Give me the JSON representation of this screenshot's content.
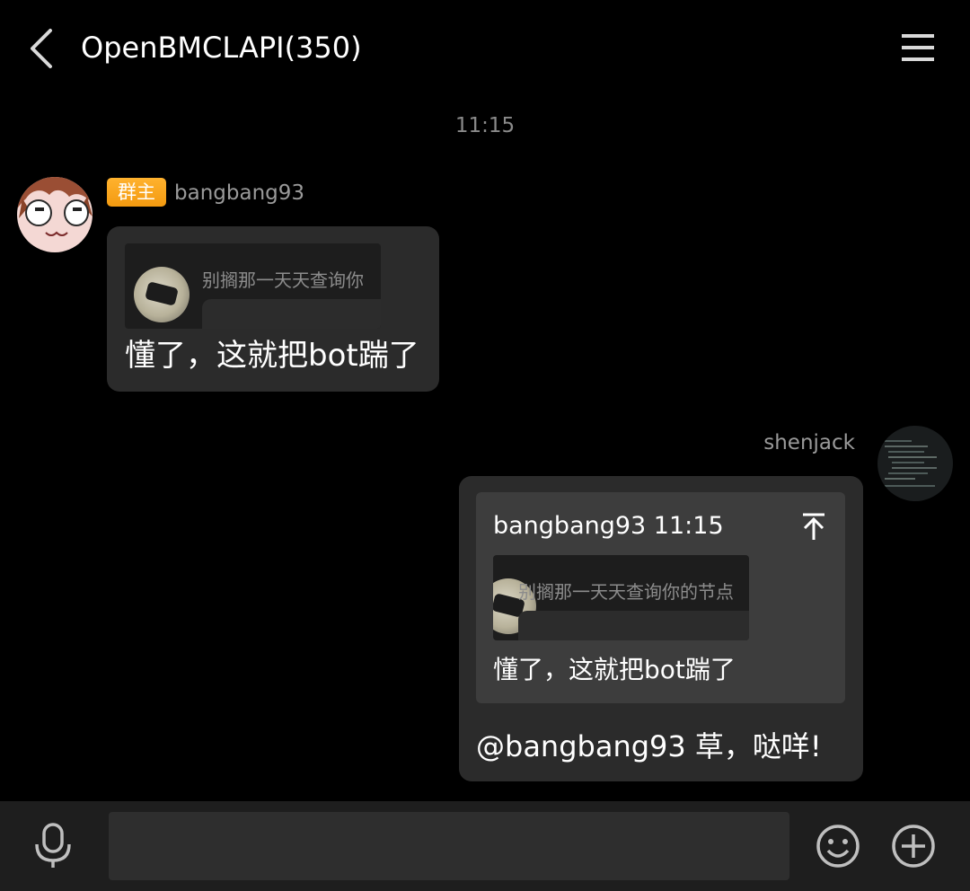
{
  "header": {
    "title": "OpenBMCLAPI(350)",
    "back_icon": "chevron-left-icon",
    "menu_icon": "hamburger-menu-icon"
  },
  "time_divider": "11:15",
  "messages": [
    {
      "side": "left",
      "badge": "群主",
      "sender": "bangbang93",
      "image_preview_text": "别搁那一天天查询你",
      "text": "懂了，这就把bot踹了"
    },
    {
      "side": "right",
      "sender": "shenjack",
      "quote": {
        "header": "bangbang93 11:15",
        "image_preview_text": "别搁那一天天查询你的节点",
        "text": "懂了，这就把bot踹了",
        "jump_icon": "jump-to-top-icon"
      },
      "text": "@bangbang93 草，哒咩!"
    }
  ],
  "input_bar": {
    "mic_icon": "microphone-icon",
    "placeholder": "",
    "emoji_icon": "smiley-icon",
    "plus_icon": "plus-circle-icon"
  },
  "colors": {
    "background": "#000000",
    "bubble": "#2b2b2b",
    "quote_card": "#3d3d3d",
    "owner_badge": "#f5a623",
    "secondary_text": "#9a9a9a",
    "input_bar": "#1e1e1e"
  }
}
